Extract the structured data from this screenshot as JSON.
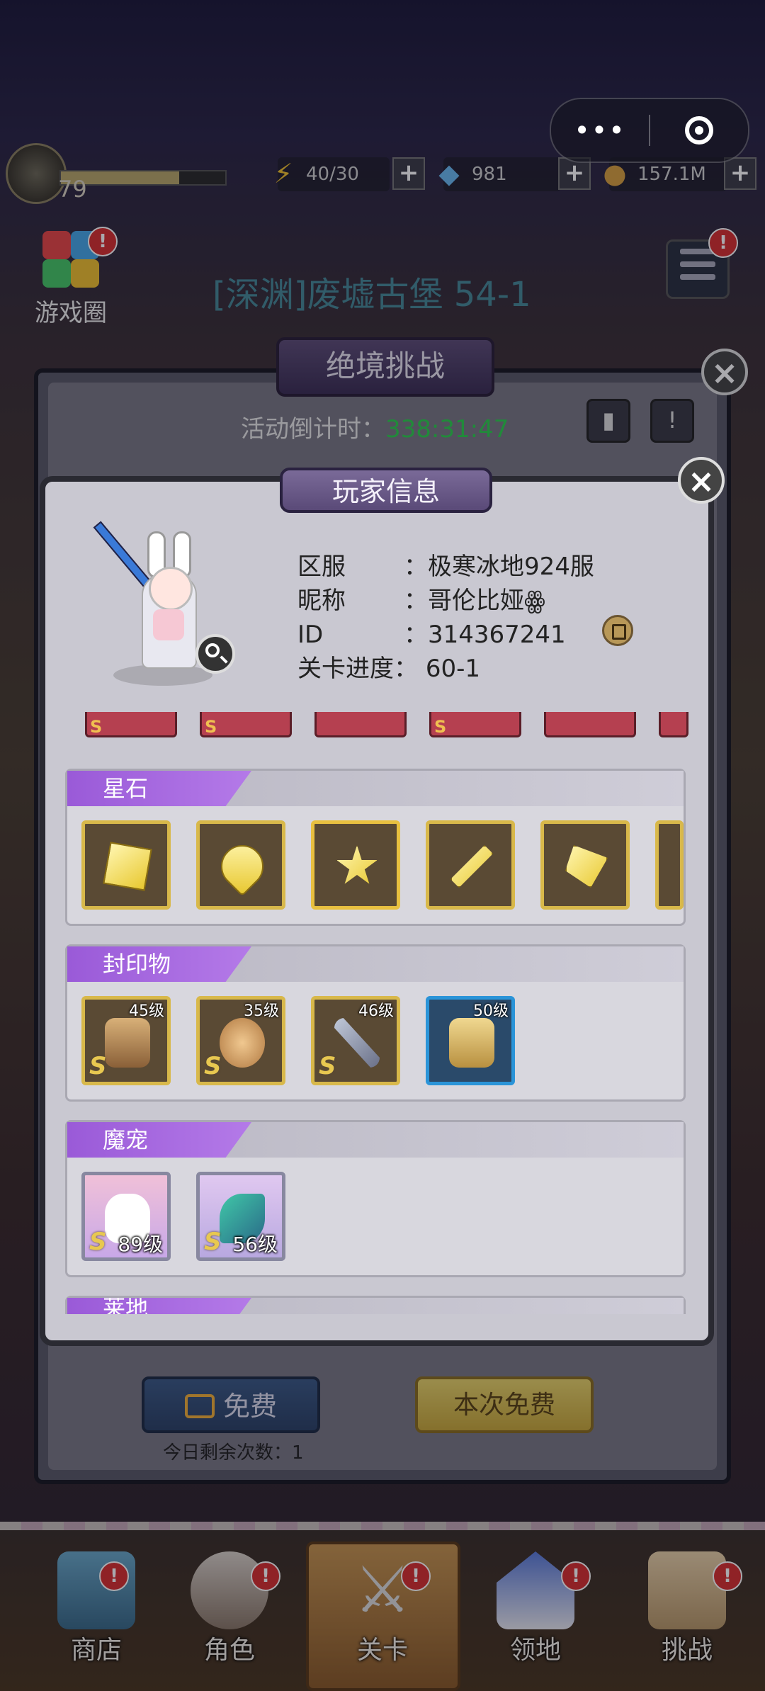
{
  "capsule": {
    "more": "•••"
  },
  "topbar": {
    "level": "79",
    "xp_fraction": 0.72,
    "energy": "40/30",
    "gems": "981",
    "coins": "157.1M"
  },
  "game": {
    "gamecircle_label": "游戏圈",
    "zone_title": "[深渊]废墟古堡 54-1"
  },
  "challenge": {
    "title": "绝境挑战",
    "countdown_label": "活动倒计时：",
    "countdown_time": "338:31:47",
    "free_label": "免费",
    "free_this_time": "本次免费",
    "remaining": "今日剩余次数：1"
  },
  "player": {
    "title": "玩家信息",
    "server_key": "区服",
    "server_val": "：极寒冰地924服",
    "nick_key": "昵称",
    "nick_val": "：哥伦比娅ꙮ",
    "id_key": "ID",
    "id_val": "：314367241",
    "progress_key": "关卡进度：",
    "progress_val": "60-1"
  },
  "sections": {
    "starstone": {
      "title": "星石"
    },
    "seal": {
      "title": "封印物",
      "items": [
        {
          "level": "45级",
          "icon": "puppet-icon"
        },
        {
          "level": "35级",
          "icon": "coin-icon"
        },
        {
          "level": "46级",
          "icon": "fork-knife-icon"
        },
        {
          "level": "50级",
          "icon": "car-icon"
        }
      ]
    },
    "pet": {
      "title": "魔宠",
      "items": [
        {
          "level": "89级",
          "icon": "bunny-icon"
        },
        {
          "level": "56级",
          "icon": "peacock-icon"
        }
      ]
    },
    "next": {
      "title": "莱地"
    }
  },
  "rarity": "S",
  "nav": [
    {
      "label": "商店",
      "badge": "!"
    },
    {
      "label": "角色",
      "badge": "!"
    },
    {
      "label": "关卡",
      "badge": "!"
    },
    {
      "label": "领地",
      "badge": "!"
    },
    {
      "label": "挑战",
      "badge": "!"
    }
  ],
  "badge": "!",
  "colors": {
    "accent_purple": "#9a5ad8",
    "gold": "#d8b84a",
    "countdown_green": "#2fcf4f"
  }
}
